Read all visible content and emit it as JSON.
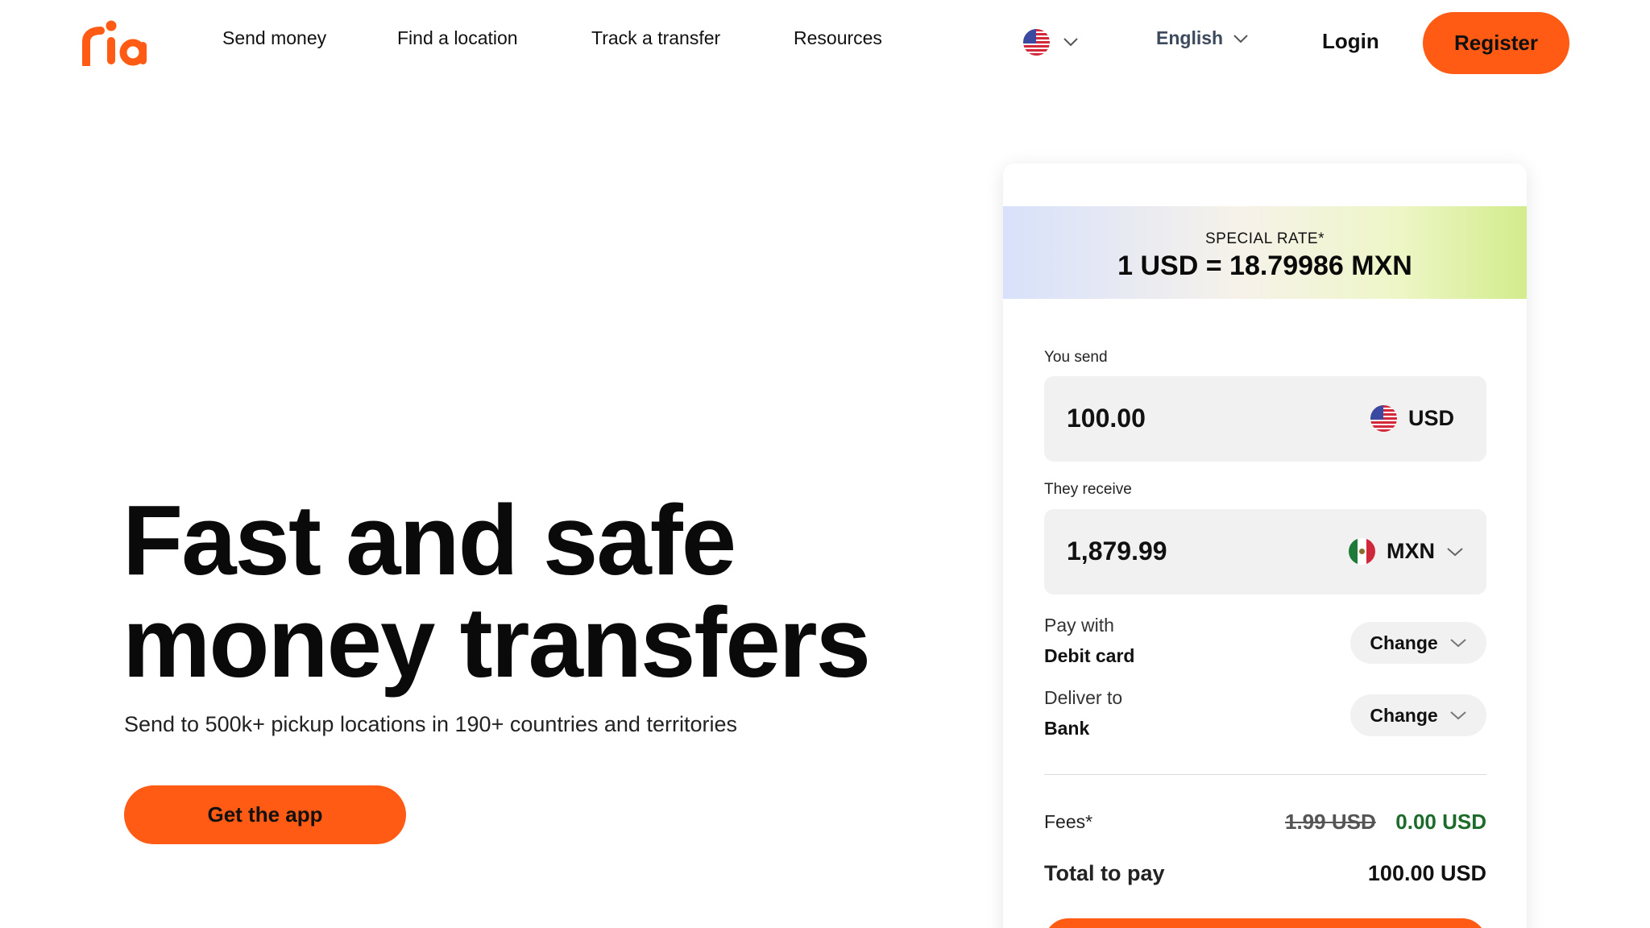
{
  "brand": {
    "logo_text": "ria",
    "accent": "#ff5b14",
    "green": "#1c6b2a"
  },
  "nav": {
    "items": [
      "Send money",
      "Find a location",
      "Track a transfer",
      "Resources"
    ],
    "country_flag_icon": "us-flag-icon",
    "language": "English",
    "login": "Login",
    "register": "Register"
  },
  "hero": {
    "title_line1": "Fast and safe",
    "title_line2": "money transfers",
    "subtitle": "Send to 500k+ pickup locations in 190+ countries and territories",
    "cta": "Get the app"
  },
  "calculator": {
    "rate_label": "SPECIAL RATE*",
    "rate_value": "1 USD = 18.79986 MXN",
    "send_label": "You send",
    "send_amount": "100.00",
    "send_currency": "USD",
    "receive_label": "They receive",
    "receive_amount": "1,879.99",
    "receive_currency": "MXN",
    "pay_with_label": "Pay with",
    "pay_with_value": "Debit card",
    "deliver_to_label": "Deliver to",
    "deliver_to_value": "Bank",
    "change_label": "Change",
    "fees_label": "Fees*",
    "fees_old": "1.99 USD",
    "fees_new": "0.00 USD",
    "total_label": "Total to pay",
    "total_value": "100.00 USD"
  }
}
